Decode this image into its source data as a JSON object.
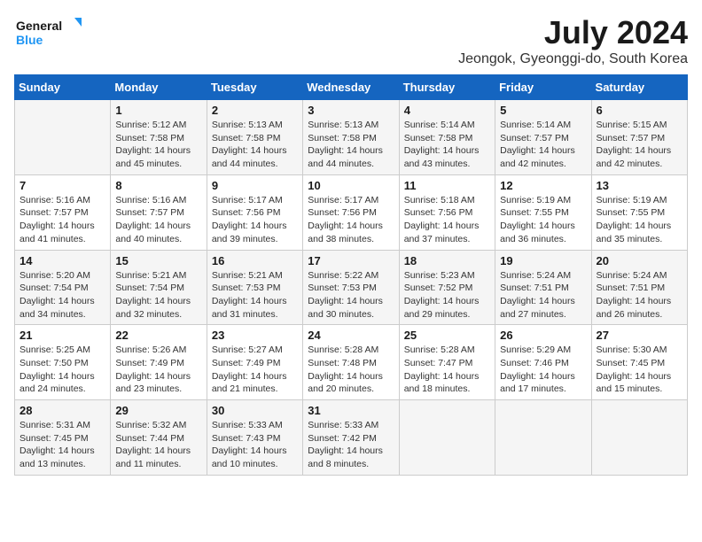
{
  "logo": {
    "line1": "General",
    "line2": "Blue"
  },
  "title": "July 2024",
  "subtitle": "Jeongok, Gyeonggi-do, South Korea",
  "days_header": [
    "Sunday",
    "Monday",
    "Tuesday",
    "Wednesday",
    "Thursday",
    "Friday",
    "Saturday"
  ],
  "weeks": [
    [
      {
        "day": "",
        "info": ""
      },
      {
        "day": "1",
        "info": "Sunrise: 5:12 AM\nSunset: 7:58 PM\nDaylight: 14 hours\nand 45 minutes."
      },
      {
        "day": "2",
        "info": "Sunrise: 5:13 AM\nSunset: 7:58 PM\nDaylight: 14 hours\nand 44 minutes."
      },
      {
        "day": "3",
        "info": "Sunrise: 5:13 AM\nSunset: 7:58 PM\nDaylight: 14 hours\nand 44 minutes."
      },
      {
        "day": "4",
        "info": "Sunrise: 5:14 AM\nSunset: 7:58 PM\nDaylight: 14 hours\nand 43 minutes."
      },
      {
        "day": "5",
        "info": "Sunrise: 5:14 AM\nSunset: 7:57 PM\nDaylight: 14 hours\nand 42 minutes."
      },
      {
        "day": "6",
        "info": "Sunrise: 5:15 AM\nSunset: 7:57 PM\nDaylight: 14 hours\nand 42 minutes."
      }
    ],
    [
      {
        "day": "7",
        "info": "Sunrise: 5:16 AM\nSunset: 7:57 PM\nDaylight: 14 hours\nand 41 minutes."
      },
      {
        "day": "8",
        "info": "Sunrise: 5:16 AM\nSunset: 7:57 PM\nDaylight: 14 hours\nand 40 minutes."
      },
      {
        "day": "9",
        "info": "Sunrise: 5:17 AM\nSunset: 7:56 PM\nDaylight: 14 hours\nand 39 minutes."
      },
      {
        "day": "10",
        "info": "Sunrise: 5:17 AM\nSunset: 7:56 PM\nDaylight: 14 hours\nand 38 minutes."
      },
      {
        "day": "11",
        "info": "Sunrise: 5:18 AM\nSunset: 7:56 PM\nDaylight: 14 hours\nand 37 minutes."
      },
      {
        "day": "12",
        "info": "Sunrise: 5:19 AM\nSunset: 7:55 PM\nDaylight: 14 hours\nand 36 minutes."
      },
      {
        "day": "13",
        "info": "Sunrise: 5:19 AM\nSunset: 7:55 PM\nDaylight: 14 hours\nand 35 minutes."
      }
    ],
    [
      {
        "day": "14",
        "info": "Sunrise: 5:20 AM\nSunset: 7:54 PM\nDaylight: 14 hours\nand 34 minutes."
      },
      {
        "day": "15",
        "info": "Sunrise: 5:21 AM\nSunset: 7:54 PM\nDaylight: 14 hours\nand 32 minutes."
      },
      {
        "day": "16",
        "info": "Sunrise: 5:21 AM\nSunset: 7:53 PM\nDaylight: 14 hours\nand 31 minutes."
      },
      {
        "day": "17",
        "info": "Sunrise: 5:22 AM\nSunset: 7:53 PM\nDaylight: 14 hours\nand 30 minutes."
      },
      {
        "day": "18",
        "info": "Sunrise: 5:23 AM\nSunset: 7:52 PM\nDaylight: 14 hours\nand 29 minutes."
      },
      {
        "day": "19",
        "info": "Sunrise: 5:24 AM\nSunset: 7:51 PM\nDaylight: 14 hours\nand 27 minutes."
      },
      {
        "day": "20",
        "info": "Sunrise: 5:24 AM\nSunset: 7:51 PM\nDaylight: 14 hours\nand 26 minutes."
      }
    ],
    [
      {
        "day": "21",
        "info": "Sunrise: 5:25 AM\nSunset: 7:50 PM\nDaylight: 14 hours\nand 24 minutes."
      },
      {
        "day": "22",
        "info": "Sunrise: 5:26 AM\nSunset: 7:49 PM\nDaylight: 14 hours\nand 23 minutes."
      },
      {
        "day": "23",
        "info": "Sunrise: 5:27 AM\nSunset: 7:49 PM\nDaylight: 14 hours\nand 21 minutes."
      },
      {
        "day": "24",
        "info": "Sunrise: 5:28 AM\nSunset: 7:48 PM\nDaylight: 14 hours\nand 20 minutes."
      },
      {
        "day": "25",
        "info": "Sunrise: 5:28 AM\nSunset: 7:47 PM\nDaylight: 14 hours\nand 18 minutes."
      },
      {
        "day": "26",
        "info": "Sunrise: 5:29 AM\nSunset: 7:46 PM\nDaylight: 14 hours\nand 17 minutes."
      },
      {
        "day": "27",
        "info": "Sunrise: 5:30 AM\nSunset: 7:45 PM\nDaylight: 14 hours\nand 15 minutes."
      }
    ],
    [
      {
        "day": "28",
        "info": "Sunrise: 5:31 AM\nSunset: 7:45 PM\nDaylight: 14 hours\nand 13 minutes."
      },
      {
        "day": "29",
        "info": "Sunrise: 5:32 AM\nSunset: 7:44 PM\nDaylight: 14 hours\nand 11 minutes."
      },
      {
        "day": "30",
        "info": "Sunrise: 5:33 AM\nSunset: 7:43 PM\nDaylight: 14 hours\nand 10 minutes."
      },
      {
        "day": "31",
        "info": "Sunrise: 5:33 AM\nSunset: 7:42 PM\nDaylight: 14 hours\nand 8 minutes."
      },
      {
        "day": "",
        "info": ""
      },
      {
        "day": "",
        "info": ""
      },
      {
        "day": "",
        "info": ""
      }
    ]
  ]
}
